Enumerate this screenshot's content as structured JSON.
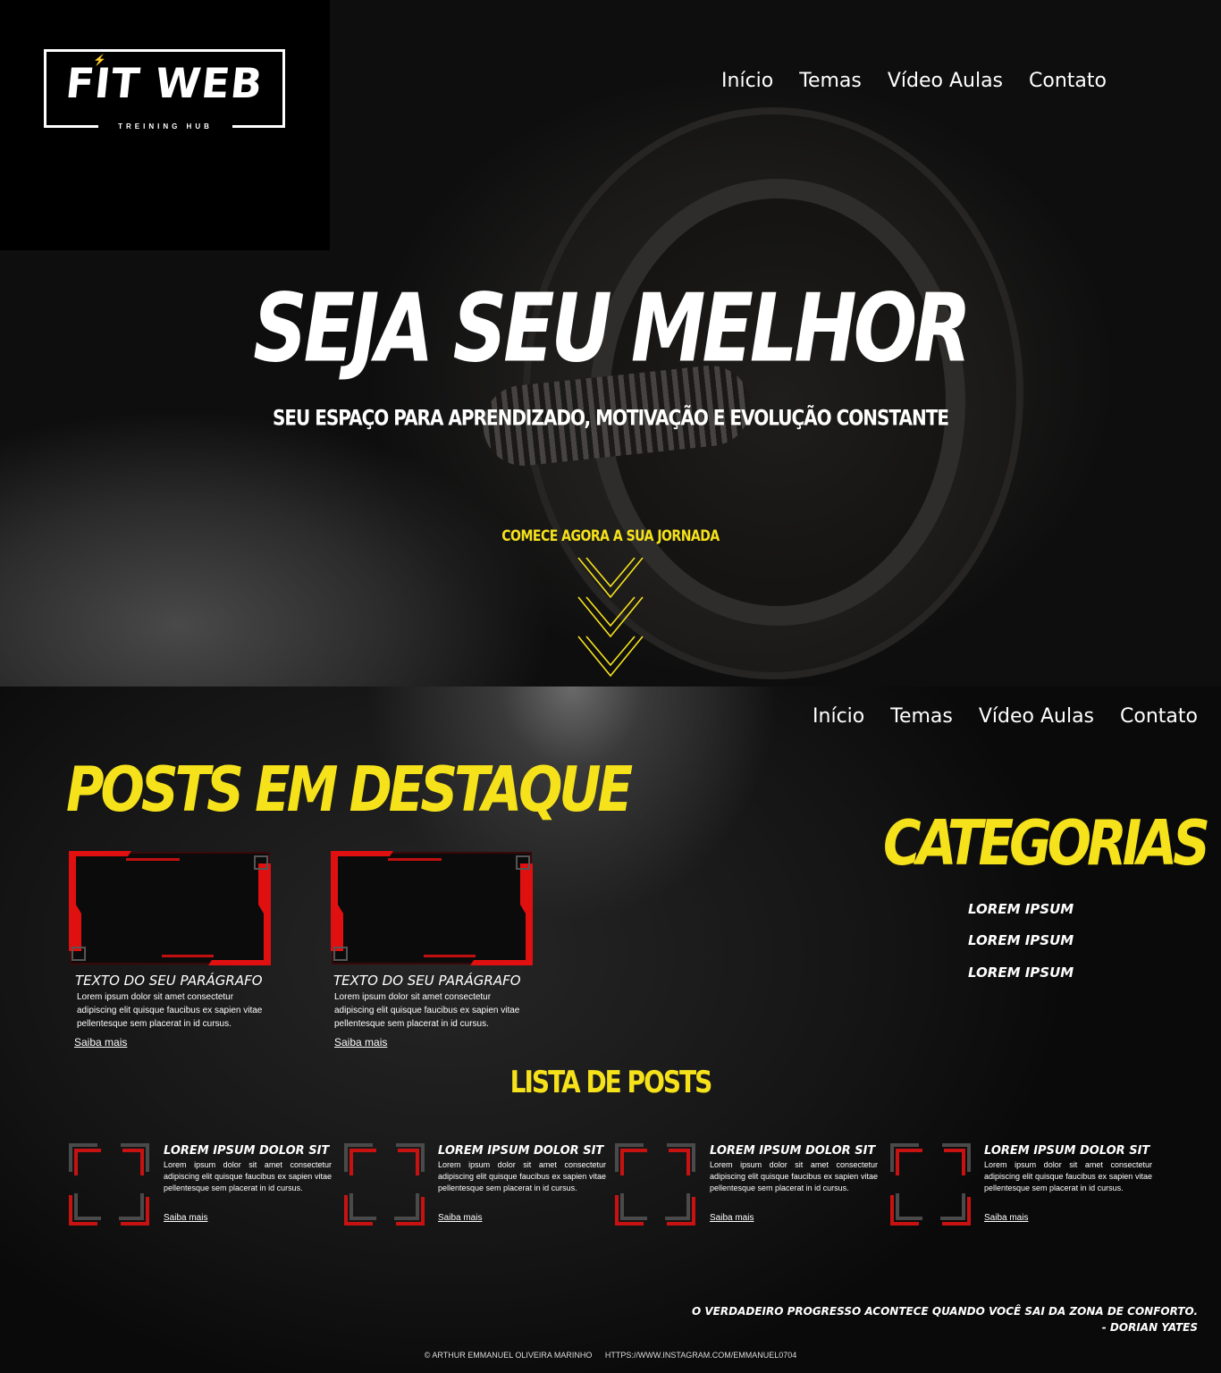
{
  "brand": {
    "logo_text": "FIT WEB",
    "logo_subtitle": "TREINING HUB"
  },
  "nav": {
    "items": [
      "Início",
      "Temas",
      "Vídeo Aulas",
      "Contato"
    ]
  },
  "hero": {
    "title": "SEJA SEU MELHOR",
    "subtitle": "SEU ESPAÇO PARA APRENDIZADO, MOTIVAÇÃO E EVOLUÇÃO CONSTANTE",
    "cta": "COMECE AGORA A SUA JORNADA",
    "cta_icon": "triple-chevron-down-icon"
  },
  "featured": {
    "title": "POSTS EM DESTAQUE",
    "cards": [
      {
        "title": "TEXTO DO SEU PARÁGRAFO",
        "text": "Lorem ipsum dolor sit amet consectetur adipiscing elit quisque faucibus ex sapien vitae pellentesque sem placerat in id cursus.",
        "link": "Saiba mais"
      },
      {
        "title": "TEXTO DO SEU PARÁGRAFO",
        "text": "Lorem ipsum dolor sit amet consectetur adipiscing elit quisque faucibus ex sapien vitae pellentesque sem placerat in id cursus.",
        "link": "Saiba mais"
      }
    ]
  },
  "categories": {
    "title": "CATEGORIAS",
    "items": [
      "LOREM IPSUM",
      "LOREM IPSUM",
      "LOREM IPSUM"
    ]
  },
  "post_list": {
    "title": "LISTA DE POSTS",
    "items": [
      {
        "title": "LOREM IPSUM DOLOR SIT",
        "text": "Lorem ipsum dolor sit amet consectetur adipiscing elit quisque faucibus ex sapien vitae pellentesque sem placerat in id cursus.",
        "link": "Saiba mais"
      },
      {
        "title": "LOREM IPSUM DOLOR SIT",
        "text": "Lorem ipsum dolor sit amet consectetur adipiscing elit quisque faucibus ex sapien vitae pellentesque sem placerat in id cursus.",
        "link": "Saiba mais"
      },
      {
        "title": "LOREM IPSUM DOLOR SIT",
        "text": "Lorem ipsum dolor sit amet consectetur adipiscing elit quisque faucibus ex sapien vitae pellentesque sem placerat in id cursus.",
        "link": "Saiba mais"
      },
      {
        "title": "LOREM IPSUM DOLOR SIT",
        "text": "Lorem ipsum dolor sit amet consectetur adipiscing elit quisque faucibus ex sapien vitae pellentesque sem placerat in id cursus.",
        "link": "Saiba mais"
      }
    ]
  },
  "quote": {
    "text": "O VERDADEIRO PROGRESSO ACONTECE QUANDO VOCÊ SAI DA ZONA DE CONFORTO.",
    "author": "- DORIAN YATES"
  },
  "footer": {
    "copyright": "© ARTHUR EMMANUEL OLIVEIRA MARINHO",
    "instagram": "HTTPS://WWW.INSTAGRAM.COM/EMMANUEL0704"
  },
  "colors": {
    "accent": "#f6e21b",
    "frame_red": "#e01010",
    "background": "#000000"
  }
}
